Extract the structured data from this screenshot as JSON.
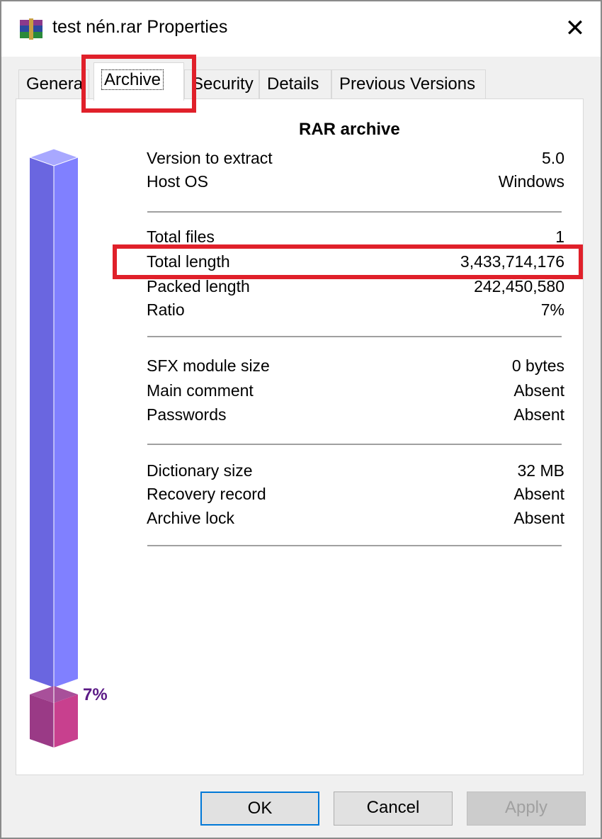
{
  "window": {
    "title": "test nén.rar Properties",
    "icon": "winrar-archive-icon",
    "close_icon": "close-icon"
  },
  "tabs": [
    {
      "label": "General",
      "active": false
    },
    {
      "label": "Archive",
      "active": true
    },
    {
      "label": "Security",
      "active": false
    },
    {
      "label": "Details",
      "active": false
    },
    {
      "label": "Previous Versions",
      "active": false
    }
  ],
  "archive": {
    "heading": "RAR archive",
    "groups": [
      [
        {
          "label": "Version to extract",
          "value": "5.0"
        },
        {
          "label": "Host OS",
          "value": "Windows"
        }
      ],
      [
        {
          "label": "Total files",
          "value": "1"
        },
        {
          "label": "Total length",
          "value": "3,433,714,176"
        },
        {
          "label": "Packed length",
          "value": "242,450,580"
        },
        {
          "label": "Ratio",
          "value": "7%"
        }
      ],
      [
        {
          "label": "SFX module size",
          "value": "0 bytes"
        },
        {
          "label": "Main comment",
          "value": "Absent"
        },
        {
          "label": "Passwords",
          "value": "Absent"
        }
      ],
      [
        {
          "label": "Dictionary size",
          "value": "32 MB"
        },
        {
          "label": "Recovery record",
          "value": "Absent"
        },
        {
          "label": "Archive lock",
          "value": "Absent"
        }
      ]
    ],
    "ratio_bar": {
      "percent": 7,
      "label": "7%",
      "colors": {
        "full_left": "#6a66e0",
        "full_right": "#8080ff",
        "fill_left": "#9a3a86",
        "fill_right": "#c8408e"
      }
    }
  },
  "buttons": {
    "ok": "OK",
    "cancel": "Cancel",
    "apply": "Apply"
  },
  "annotations": {
    "color": "#e0202a"
  }
}
